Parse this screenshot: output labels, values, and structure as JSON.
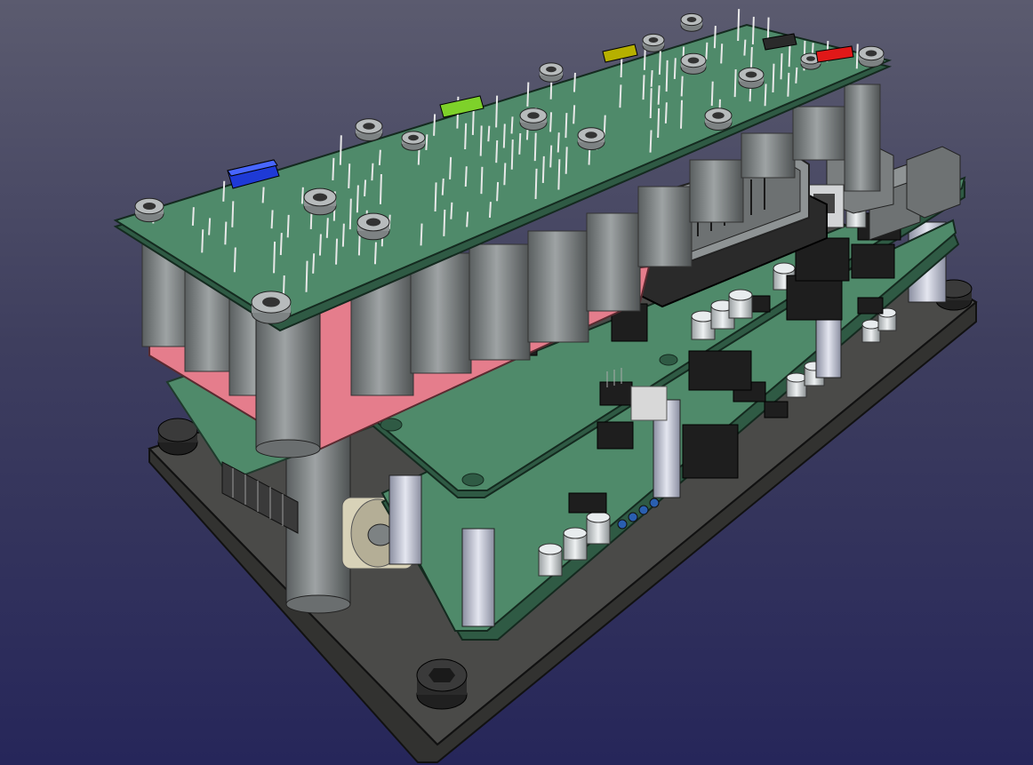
{
  "scene": {
    "subject": "pcb-stack-3d-model",
    "colors": {
      "background_top": "#5b5b6f",
      "background_bottom": "#26265a",
      "base_plate": "#4a4a48",
      "base_plate_side": "#323230",
      "pcb_green": "#4f8a6a",
      "pcb_edge": "#2f5a44",
      "battery_gray": "#7d8283",
      "battery_dark": "#55595a",
      "insulator_pink": "#e57d8c",
      "standoff": "#b8bcc8",
      "connector_gray": "#8e9394",
      "header_black": "#1e1e1e",
      "fuse_blue": "#1e3ad6",
      "fuse_green": "#7ed12a",
      "fuse_yellow": "#b6b000",
      "fuse_red": "#e01818",
      "screw_black": "#202020",
      "capacitor_silver": "#cfd4d6"
    }
  }
}
